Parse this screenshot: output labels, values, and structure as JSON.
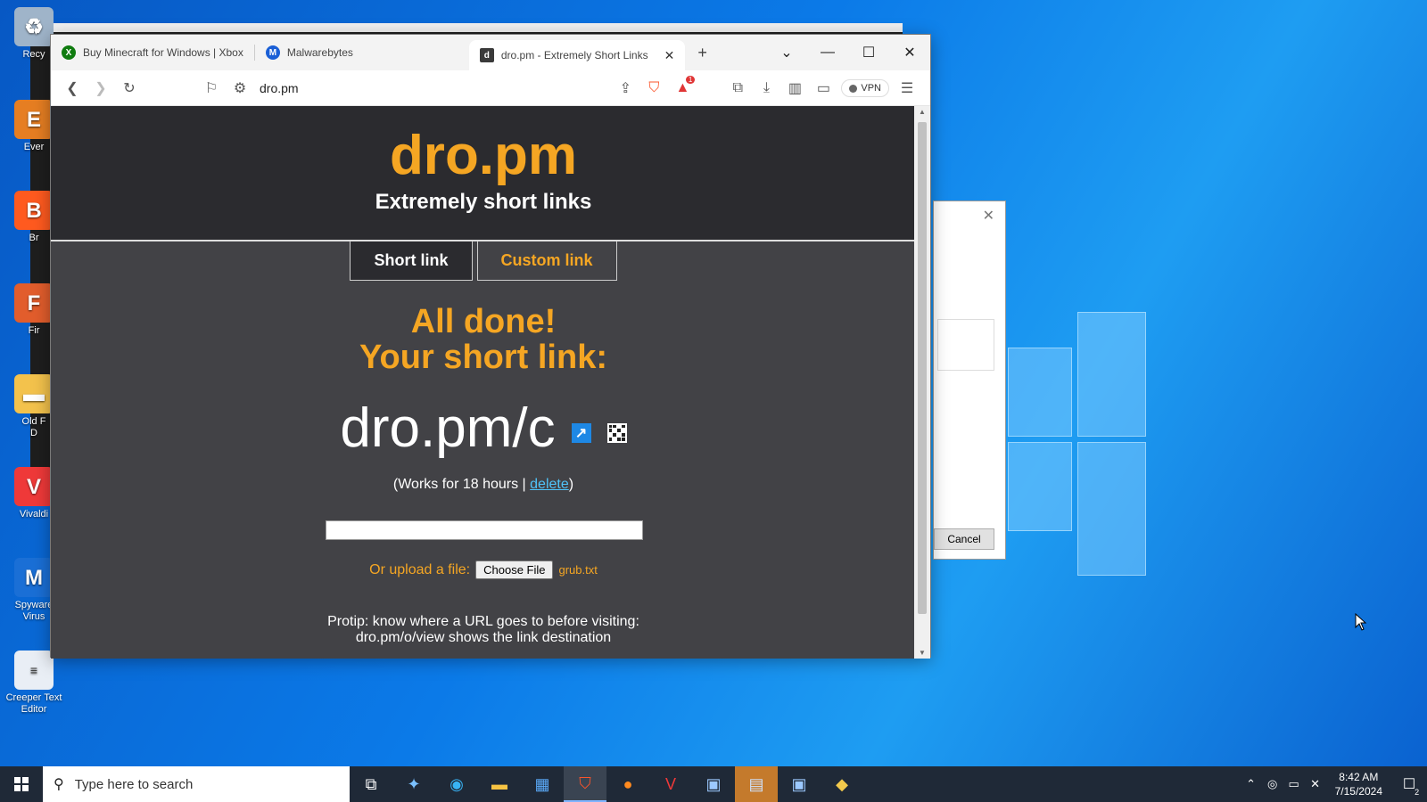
{
  "desktop": {
    "icons": [
      {
        "label": "Recy",
        "color": "#9fb4c9"
      },
      {
        "label": "Ever",
        "color": "#e67e22"
      },
      {
        "label": "Br",
        "color": "#ff5a1f"
      },
      {
        "label": "Fir",
        "color": "#e25d2c"
      },
      {
        "label": "Old F\nD",
        "color": "#f3c24c"
      },
      {
        "label": "Vivaldi",
        "color": "#ef3939"
      },
      {
        "label": "Spyware\nVirus",
        "color": "#1a6fd6"
      },
      {
        "label": "Creeper Text\nEditor",
        "color": "#e9eef5"
      }
    ]
  },
  "dialog": {
    "cancel_label": "Cancel",
    "close": "✕"
  },
  "browser": {
    "tabs": [
      {
        "label": "Buy Minecraft for Windows | Xbox",
        "icon": "xbox-icon",
        "color": "#107c10"
      },
      {
        "label": "Malwarebytes",
        "icon": "malwarebytes-icon",
        "color": "#1a5fd6"
      },
      {
        "label": "dro.pm - Extremely Short Links",
        "icon": "dropm-icon",
        "color": "#3a3a3a",
        "active": true
      }
    ],
    "new_tab": "+",
    "tab_menu": "⌄",
    "window_controls": {
      "minimize": "—",
      "maximize": "☐",
      "close": "✕"
    },
    "url": "dro.pm",
    "vpn_label": "VPN",
    "shields_badge": "1"
  },
  "page": {
    "title": "dro.pm",
    "subtitle": "Extremely short links",
    "tabs": [
      "Short link",
      "Custom link"
    ],
    "done_line1": "All done!",
    "done_line2": "Your short link:",
    "short_link": "dro.pm/c",
    "works_prefix": "(Works for 18 hours | ",
    "delete_label": "delete",
    "works_suffix": ")",
    "upload_label": "Or upload a file:",
    "choose_file": "Choose File",
    "file_name": "grub.txt",
    "protip_line1": "Protip: know where a URL goes to before visiting:",
    "protip_line2": "dro.pm/o/view shows the link destination",
    "accent_color": "#f5a623"
  },
  "taskbar": {
    "search_placeholder": "Type here to search",
    "time": "8:42 AM",
    "date": "7/15/2024",
    "notification_count": "2"
  }
}
